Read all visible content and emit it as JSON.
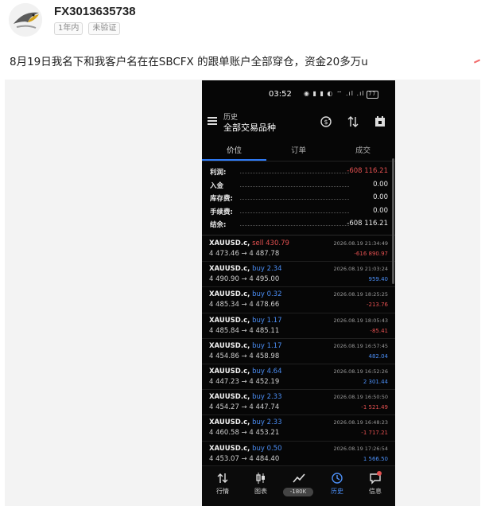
{
  "post": {
    "username": "FX3013635738",
    "badges": [
      "1年内",
      "未验证"
    ],
    "text": "8月19日我名下和我客户名在在SBCFX 的跟单账户全部穿仓，资金20多万u"
  },
  "phone": {
    "status": {
      "time": "03:52",
      "icons": "◉ ▮ ▮ ◐ ⌔ .ıl .ıl",
      "battery": "77"
    },
    "header": {
      "small_title": "历史",
      "main_title": "全部交易品种"
    },
    "tabs": [
      "价位",
      "订单",
      "成交"
    ],
    "summary": [
      {
        "label": "利润:",
        "value": "-608 116.21",
        "negative": true
      },
      {
        "label": "入金",
        "value": "0.00",
        "negative": false
      },
      {
        "label": "库存费:",
        "value": "0.00",
        "negative": false
      },
      {
        "label": "手续费:",
        "value": "0.00",
        "negative": false
      },
      {
        "label": "结余:",
        "value": "-608 116.21",
        "negative": false
      }
    ],
    "deals": [
      {
        "symbol": "XAUUSD.c,",
        "side": "sell 430.79",
        "prices": "4 473.46 → 4 487.78",
        "time": "2026.08.19 21:34:49",
        "profit": "-616 890.97",
        "negative": true
      },
      {
        "symbol": "XAUUSD.c,",
        "side": "buy 2.34",
        "prices": "4 490.90 → 4 495.00",
        "time": "2026.08.19 21:03:24",
        "profit": "959.40",
        "negative": false
      },
      {
        "symbol": "XAUUSD.c,",
        "side": "buy 0.32",
        "prices": "4 485.34 → 4 478.66",
        "time": "2026.08.19 18:25:25",
        "profit": "-213.76",
        "negative": true
      },
      {
        "symbol": "XAUUSD.c,",
        "side": "buy 1.17",
        "prices": "4 485.84 → 4 485.11",
        "time": "2026.08.19 18:05:43",
        "profit": "-85.41",
        "negative": true
      },
      {
        "symbol": "XAUUSD.c,",
        "side": "buy 1.17",
        "prices": "4 454.86 → 4 458.98",
        "time": "2026.08.19 16:57:45",
        "profit": "482.04",
        "negative": false
      },
      {
        "symbol": "XAUUSD.c,",
        "side": "buy 4.64",
        "prices": "4 447.23 → 4 452.19",
        "time": "2026.08.19 16:52:26",
        "profit": "2 301.44",
        "negative": false
      },
      {
        "symbol": "XAUUSD.c,",
        "side": "buy 2.33",
        "prices": "4 454.27 → 4 447.74",
        "time": "2026.08.19 16:50:50",
        "profit": "-1 521.49",
        "negative": true
      },
      {
        "symbol": "XAUUSD.c,",
        "side": "buy 2.33",
        "prices": "4 460.58 → 4 453.21",
        "time": "2026.08.19 16:48:23",
        "profit": "-1 717.21",
        "negative": true
      },
      {
        "symbol": "XAUUSD.c,",
        "side": "buy 0.50",
        "prices": "4 453.07 → 4 484.40",
        "time": "2026.08.19 17:26:54",
        "profit": "1 566.50",
        "negative": false
      }
    ],
    "nav": [
      {
        "label": "行情",
        "icon": "swap-arrows-icon"
      },
      {
        "label": "图表",
        "icon": "candlestick-icon"
      },
      {
        "label": "",
        "pill": "-180K",
        "icon": "trend-line-icon"
      },
      {
        "label": "历史",
        "icon": "history-clock-icon",
        "active": true
      },
      {
        "label": "信息",
        "icon": "message-icon"
      }
    ]
  },
  "colors": {
    "accent": "#2f7bf6",
    "negative": "#e45050",
    "positive": "#4b8ef5"
  }
}
